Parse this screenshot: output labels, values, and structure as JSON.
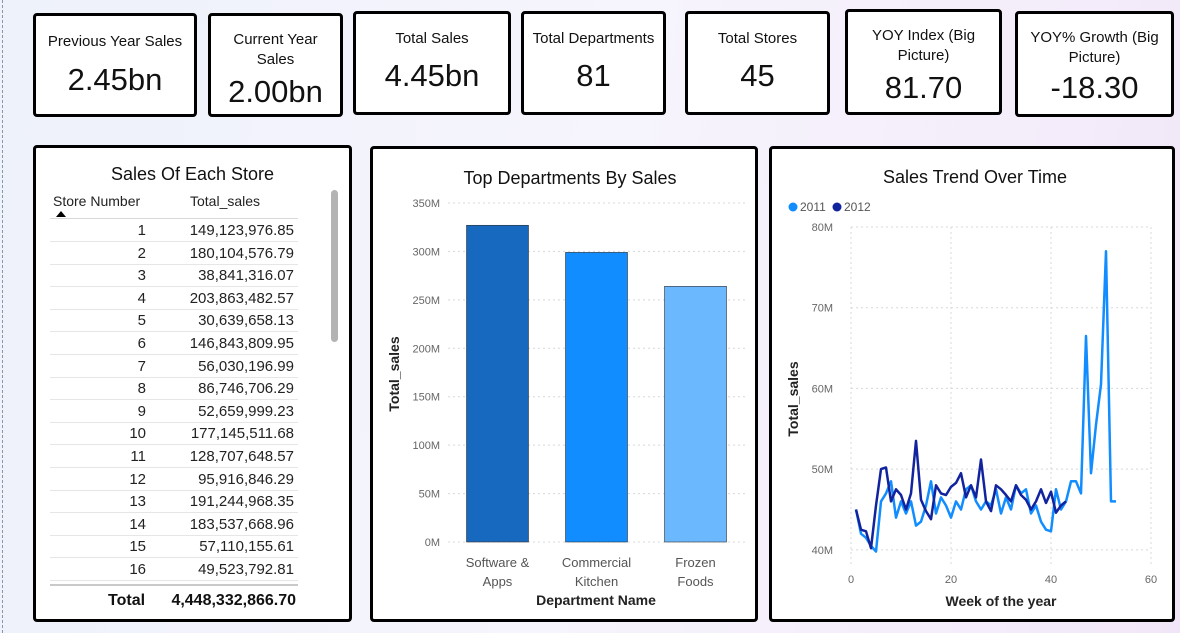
{
  "kpis": [
    {
      "label": "Previous Year Sales",
      "value": "2.45bn"
    },
    {
      "label": "Current Year Sales",
      "value": "2.00bn"
    },
    {
      "label": "Total Sales",
      "value": "4.45bn"
    },
    {
      "label": "Total Departments",
      "value": "81"
    },
    {
      "label": "Total Stores",
      "value": "45"
    },
    {
      "label": "YOY Index (Big Picture)",
      "value": "81.70"
    },
    {
      "label": "YOY% Growth (Big Picture)",
      "value": "-18.30"
    }
  ],
  "store_table": {
    "title": "Sales Of Each Store",
    "col1": "Store Number",
    "col2": "Total_sales",
    "rows": [
      {
        "store": "1",
        "sales": "149,123,976.85"
      },
      {
        "store": "2",
        "sales": "180,104,576.79"
      },
      {
        "store": "3",
        "sales": "38,841,316.07"
      },
      {
        "store": "4",
        "sales": "203,863,482.57"
      },
      {
        "store": "5",
        "sales": "30,639,658.13"
      },
      {
        "store": "6",
        "sales": "146,843,809.95"
      },
      {
        "store": "7",
        "sales": "56,030,196.99"
      },
      {
        "store": "8",
        "sales": "86,746,706.29"
      },
      {
        "store": "9",
        "sales": "52,659,999.23"
      },
      {
        "store": "10",
        "sales": "177,145,511.68"
      },
      {
        "store": "11",
        "sales": "128,707,648.57"
      },
      {
        "store": "12",
        "sales": "95,916,846.29"
      },
      {
        "store": "13",
        "sales": "191,244,968.35"
      },
      {
        "store": "14",
        "sales": "183,537,668.96"
      },
      {
        "store": "15",
        "sales": "57,110,155.61"
      },
      {
        "store": "16",
        "sales": "49,523,792.81"
      }
    ],
    "total_label": "Total",
    "total_value": "4,448,332,866.70"
  },
  "chart_data": [
    {
      "type": "bar",
      "title": "Top Departments By Sales",
      "xlabel": "Department Name",
      "ylabel": "Total_sales",
      "categories": [
        "Software & Apps",
        "Commercial Kitchen",
        "Frozen Foods"
      ],
      "category_lines": [
        [
          "Software &",
          "Apps"
        ],
        [
          "Commercial",
          "Kitchen"
        ],
        [
          "Frozen",
          "Foods"
        ]
      ],
      "values": [
        327000000,
        299000000,
        264000000
      ],
      "colors": [
        "#1769bf",
        "#118dff",
        "#6cb8ff"
      ],
      "ylim": [
        0,
        350000000
      ],
      "yticks": [
        {
          "v": 0,
          "l": "0M"
        },
        {
          "v": 50000000,
          "l": "50M"
        },
        {
          "v": 100000000,
          "l": "100M"
        },
        {
          "v": 150000000,
          "l": "150M"
        },
        {
          "v": 200000000,
          "l": "200M"
        },
        {
          "v": 250000000,
          "l": "250M"
        },
        {
          "v": 300000000,
          "l": "300M"
        },
        {
          "v": 350000000,
          "l": "350M"
        }
      ],
      "grid": true
    },
    {
      "type": "line",
      "title": "Sales Trend Over Time",
      "xlabel": "Week of the year",
      "ylabel": "Total_sales",
      "legend": "top-left",
      "xlim": [
        0,
        60
      ],
      "ylim": [
        38000000,
        80000000
      ],
      "xticks": [
        {
          "v": 0,
          "l": "0"
        },
        {
          "v": 20,
          "l": "20"
        },
        {
          "v": 40,
          "l": "40"
        },
        {
          "v": 60,
          "l": "60"
        }
      ],
      "yticks": [
        {
          "v": 40000000,
          "l": "40M"
        },
        {
          "v": 50000000,
          "l": "50M"
        },
        {
          "v": 60000000,
          "l": "60M"
        },
        {
          "v": 70000000,
          "l": "70M"
        },
        {
          "v": 80000000,
          "l": "80M"
        }
      ],
      "grid": true,
      "series": [
        {
          "name": "2011",
          "color": "#118dff",
          "x": [
            1,
            2,
            3,
            4,
            5,
            6,
            7,
            8,
            9,
            10,
            11,
            12,
            13,
            14,
            15,
            16,
            17,
            18,
            19,
            20,
            21,
            22,
            23,
            24,
            25,
            26,
            27,
            28,
            29,
            30,
            31,
            32,
            33,
            34,
            35,
            36,
            37,
            38,
            39,
            40,
            41,
            42,
            43,
            44,
            45,
            46,
            47,
            48,
            49,
            50,
            51,
            52,
            53
          ],
          "y": [
            45.0,
            42.0,
            41.5,
            40.5,
            39.8,
            46.0,
            47.0,
            48.5,
            44.0,
            46.0,
            44.5,
            46.0,
            43.0,
            43.5,
            45.5,
            48.5,
            44.5,
            46.5,
            45.5,
            44.0,
            46.0,
            45.0,
            47.5,
            48.0,
            46.0,
            45.0,
            46.0,
            45.5,
            47.5,
            44.5,
            46.5,
            45.0,
            48.0,
            47.0,
            47.5,
            44.5,
            45.5,
            43.5,
            42.5,
            42.3,
            47.5,
            45.0,
            46.0,
            48.5,
            48.5,
            47.0,
            66.5,
            49.5,
            55.5,
            60.5,
            77.0,
            46.0,
            46.0
          ]
        },
        {
          "name": "2012",
          "color": "#12239e",
          "x": [
            1,
            2,
            3,
            4,
            5,
            6,
            7,
            8,
            9,
            10,
            11,
            12,
            13,
            14,
            15,
            16,
            17,
            18,
            19,
            20,
            21,
            22,
            23,
            24,
            25,
            26,
            27,
            28,
            29,
            30,
            31,
            32,
            33,
            34,
            35,
            36,
            37,
            38,
            39,
            40,
            41,
            42,
            43
          ],
          "y": [
            45.0,
            42.5,
            42.3,
            40.2,
            45.5,
            50.0,
            50.2,
            46.0,
            47.5,
            46.8,
            45.0,
            47.0,
            53.5,
            46.2,
            44.8,
            43.8,
            48.0,
            47.0,
            46.8,
            47.8,
            48.3,
            49.5,
            46.5,
            48.0,
            46.5,
            51.2,
            46.0,
            44.8,
            48.0,
            47.5,
            46.8,
            46.0,
            48.0,
            46.8,
            46.2,
            45.0,
            46.0,
            47.5,
            45.8,
            47.2,
            44.6,
            45.5,
            46.0
          ]
        }
      ]
    }
  ]
}
